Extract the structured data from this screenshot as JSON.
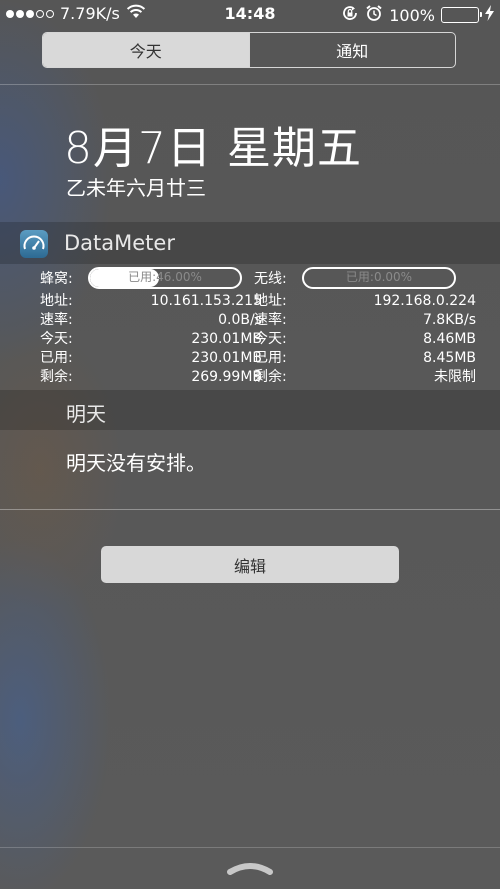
{
  "status_bar": {
    "network_speed": "7.79K/s",
    "time": "14:48",
    "battery_percent": "100%",
    "battery_level": 1.0,
    "signal_bars_filled": 3,
    "signal_bars_total": 5,
    "icons": [
      "wifi-icon",
      "rotation-lock-icon",
      "alarm-icon",
      "battery-icon",
      "charging-bolt-icon"
    ]
  },
  "tabs": [
    {
      "label": "今天",
      "selected": true
    },
    {
      "label": "通知",
      "selected": false
    }
  ],
  "today": {
    "date": "8月7日 星期五",
    "lunar_date": "乙未年六月廿三"
  },
  "datameter": {
    "app_name": "DataMeter",
    "icon": "speedometer-icon",
    "cellular": {
      "label": "蜂窝:",
      "usage_text": "已用:46.00%",
      "usage_fraction": 0.46,
      "rows": [
        {
          "key": "地址:",
          "value": "10.161.153.215"
        },
        {
          "key": "速率:",
          "value": "0.0B/s"
        },
        {
          "key": "今天:",
          "value": "230.01MB"
        },
        {
          "key": "已用:",
          "value": "230.01MB"
        },
        {
          "key": "剩余:",
          "value": "269.99MB"
        }
      ]
    },
    "wifi": {
      "label": "无线:",
      "usage_text": "已用:0.00%",
      "usage_fraction": 0.0,
      "rows": [
        {
          "key": "地址:",
          "value": "192.168.0.224"
        },
        {
          "key": "速率:",
          "value": "7.8KB/s"
        },
        {
          "key": "今天:",
          "value": "8.46MB"
        },
        {
          "key": "已用:",
          "value": "8.45MB"
        },
        {
          "key": "剩余:",
          "value": "未限制"
        }
      ]
    }
  },
  "tomorrow": {
    "title": "明天",
    "summary": "明天没有安排。"
  },
  "edit_button": "编辑",
  "colors": {
    "battery_green": "#4cd964",
    "segment_active_bg": "#d9d9d9",
    "button_bg": "#d8d8d8"
  }
}
